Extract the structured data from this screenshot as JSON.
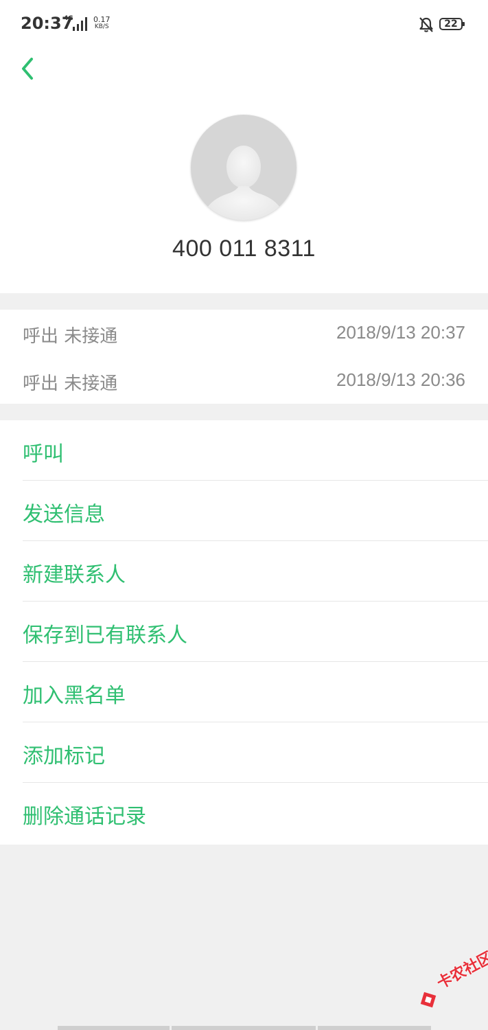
{
  "status_bar": {
    "time": "20:37",
    "network": "4G",
    "speed_value": "0.17",
    "speed_unit": "KB/S",
    "battery": "22"
  },
  "contact": {
    "phone_number": "400 011 8311"
  },
  "call_log": [
    {
      "type": "呼出 未接通",
      "time": "2018/9/13 20:37"
    },
    {
      "type": "呼出 未接通",
      "time": "2018/9/13 20:36"
    }
  ],
  "actions": [
    {
      "label": "呼叫"
    },
    {
      "label": "发送信息"
    },
    {
      "label": "新建联系人"
    },
    {
      "label": "保存到已有联系人"
    },
    {
      "label": "加入黑名单"
    },
    {
      "label": "添加标记"
    },
    {
      "label": "删除通话记录"
    }
  ],
  "watermark": {
    "text": "卡农社区"
  },
  "colors": {
    "accent": "#2fbf71",
    "secondary_text": "#8a8a8a",
    "background": "#f0f0f0"
  }
}
